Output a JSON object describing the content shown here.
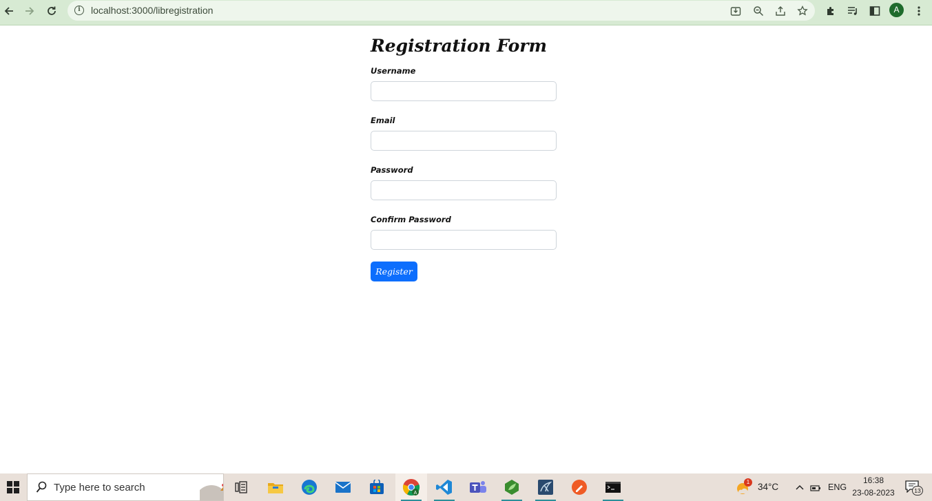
{
  "browser": {
    "url": "localhost:3000/libregistration",
    "avatar_letter": "A"
  },
  "form": {
    "title": "Registration Form",
    "fields": [
      {
        "label": "Username",
        "value": "",
        "placeholder": ""
      },
      {
        "label": "Email",
        "value": "",
        "placeholder": ""
      },
      {
        "label": "Password",
        "value": "",
        "placeholder": ""
      },
      {
        "label": "Confirm Password",
        "value": "",
        "placeholder": ""
      }
    ],
    "submit_label": "Register"
  },
  "taskbar": {
    "search_placeholder": "Type here to search",
    "weather_temp": "34°C",
    "weather_badge": "1",
    "language": "ENG",
    "time": "16:38",
    "date": "23-08-2023",
    "notification_count": "13"
  },
  "colors": {
    "browser_bar": "#d7ead3",
    "primary_button": "#0d6efd",
    "taskbar": "#e9e0d9"
  }
}
